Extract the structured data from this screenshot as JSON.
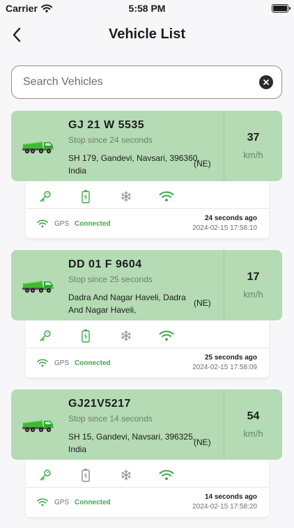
{
  "status_bar": {
    "carrier": "Carrier",
    "time": "5:58 PM"
  },
  "nav": {
    "title": "Vehicle List"
  },
  "search": {
    "placeholder": "Search Vehicles",
    "value": ""
  },
  "colors": {
    "card_header": "#b4dbb3",
    "accent_green": "#3fa94b"
  },
  "vehicles": [
    {
      "plate": "GJ 21 W 5535",
      "status": "Stop since 24 seconds",
      "address": "SH 179, Gandevi, Navsari, 396360, India",
      "direction": "(NE)",
      "speed": "37",
      "speed_unit": "km/h",
      "battery_charged": true,
      "gps_label": "GPS",
      "gps_status": "Connected",
      "last_update_ago": "24 seconds ago",
      "last_update_time": "2024-02-15 17:58:10"
    },
    {
      "plate": "DD 01 F 9604",
      "status": "Stop since 25 seconds",
      "address": "Dadra And Nagar Haveli, Dadra And Nagar Haveli,",
      "direction": "(NE)",
      "speed": "17",
      "speed_unit": "km/h",
      "battery_charged": true,
      "gps_label": "GPS",
      "gps_status": "Connected",
      "last_update_ago": "25 seconds ago",
      "last_update_time": "2024-02-15 17:58:09"
    },
    {
      "plate": "GJ21V5217",
      "status": "Stop since 14 seconds",
      "address": "SH 15, Gandevi, Navsari, 396325, India",
      "direction": "(NE)",
      "speed": "54",
      "speed_unit": "km/h",
      "battery_charged": false,
      "gps_label": "GPS",
      "gps_status": "Connected",
      "last_update_ago": "14 seconds ago",
      "last_update_time": "2024-02-15 17:58:20"
    }
  ]
}
